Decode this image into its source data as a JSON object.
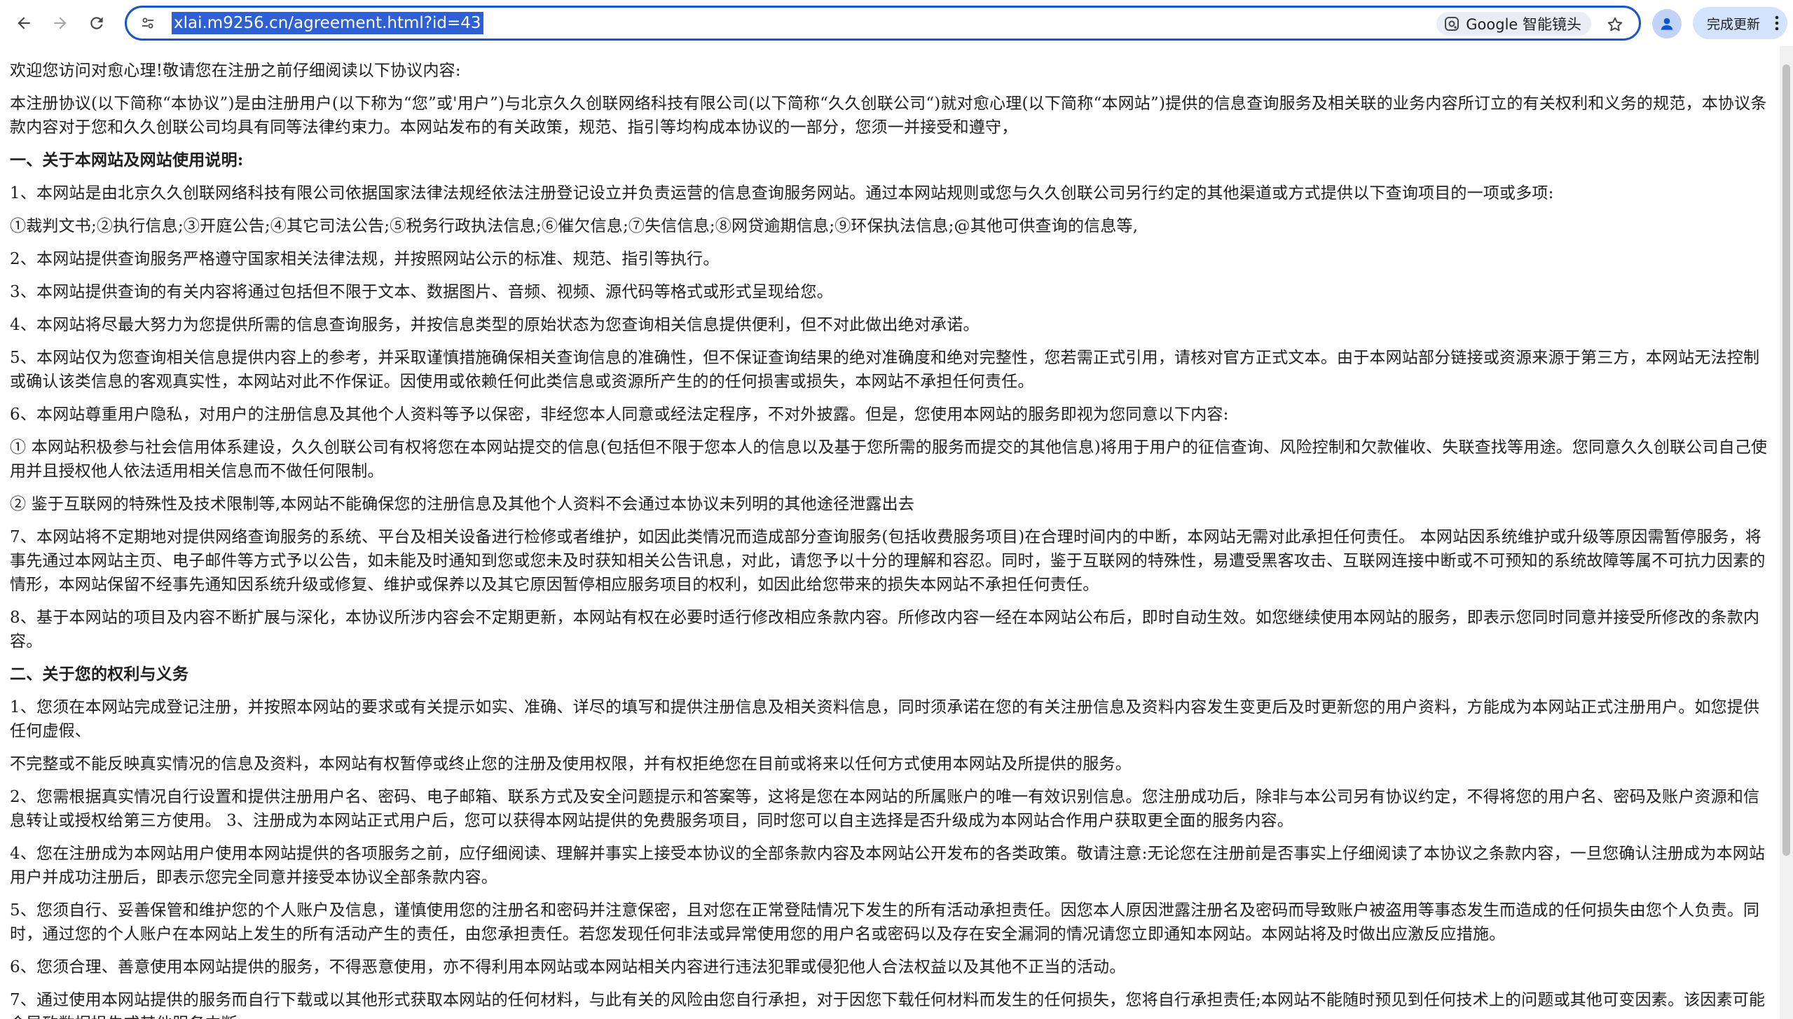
{
  "browser": {
    "url": "xlai.m9256.cn/agreement.html?id=43",
    "lens_label": "Google 智能镜头",
    "update_label": "完成更新"
  },
  "agreement": {
    "paragraphs": [
      {
        "type": "text",
        "text": "欢迎您访问对愈心理!敬请您在注册之前仔细阅读以下协议内容:"
      },
      {
        "type": "text",
        "text": "本注册协议(以下简称“本协议”)是由注册用户(以下称为“您”或'用户”)与北京久久创联网络科技有限公司(以下简称“久久创联公司“)就对愈心理(以下简称“本网站”)提供的信息查询服务及相关联的业务内容所订立的有关权利和义务的规范，本协议条款内容对于您和久久创联公司均具有同等法律约束力。本网站发布的有关政策，规范、指引等均构成本协议的一部分，您须一并接受和遵守，"
      },
      {
        "type": "heading",
        "text": "一、关于本网站及网站使用说明:"
      },
      {
        "type": "text",
        "text": "1、本网站是由北京久久创联网络科技有限公司依据国家法律法规经依法注册登记设立并负责运营的信息查询服务网站。通过本网站规则或您与久久创联公司另行约定的其他渠道或方式提供以下查询项目的一项或多项:"
      },
      {
        "type": "text",
        "text": "①裁判文书;②执行信息;③开庭公告;④其它司法公告;⑤税务行政执法信息;⑥催欠信息;⑦失信信息;⑧网贷逾期信息;⑨环保执法信息;@其他可供查询的信息等,"
      },
      {
        "type": "text",
        "text": "2、本网站提供查询服务严格遵守国家相关法律法规，并按照网站公示的标准、规范、指引等执行。"
      },
      {
        "type": "text",
        "text": "3、本网站提供查询的有关内容将通过包括但不限于文本、数据图片、音频、视频、源代码等格式或形式呈现给您。"
      },
      {
        "type": "text",
        "text": "4、本网站将尽最大努力为您提供所需的信息查询服务，并按信息类型的原始状态为您查询相关信息提供便利，但不对此做出绝对承诺。"
      },
      {
        "type": "text",
        "text": "5、本网站仅为您查询相关信息提供内容上的参考，并采取谨慎措施确保相关查询信息的准确性，但不保证查询结果的绝对准确度和绝对完整性，您若需正式引用，请核对官方正式文本。由于本网站部分链接或资源来源于第三方，本网站无法控制或确认该类信息的客观真实性，本网站对此不作保证。因使用或依赖任何此类信息或资源所产生的的任何损害或损失，本网站不承担任何责任。"
      },
      {
        "type": "text",
        "text": "6、本网站尊重用户隐私，对用户的注册信息及其他个人资料等予以保密，非经您本人同意或经法定程序，不对外披露。但是，您使用本网站的服务即视为您同意以下内容:"
      },
      {
        "type": "text",
        "text": "① 本网站积极参与社会信用体系建设，久久创联公司有权将您在本网站提交的信息(包括但不限于您本人的信息以及基于您所需的服务而提交的其他信息)将用于用户的征信查询、风险控制和欠款催收、失联查找等用途。您同意久久创联公司自己使用并且授权他人依法适用相关信息而不做任何限制。"
      },
      {
        "type": "text",
        "text": "② 鉴于互联网的特殊性及技术限制等,本网站不能确保您的注册信息及其他个人资料不会通过本协议未列明的其他途径泄露出去"
      },
      {
        "type": "text",
        "text": "7、本网站将不定期地对提供网络查询服务的系统、平台及相关设备进行检修或者维护，如因此类情况而造成部分查询服务(包括收费服务项目)在合理时间内的中断，本网站无需对此承担任何责任。 本网站因系统维护或升级等原因需暂停服务，将事先通过本网站主页、电子邮件等方式予以公告，如未能及时通知到您或您未及时获知相关公告讯息，对此，请您予以十分的理解和容忍。同时，鉴于互联网的特殊性，易遭受黑客攻击、互联网连接中断或不可预知的系统故障等属不可抗力因素的情形，本网站保留不经事先通知因系统升级或修复、维护或保养以及其它原因暂停相应服务项目的权利，如因此给您带来的损失本网站不承担任何责任。"
      },
      {
        "type": "text",
        "text": "8、基于本网站的项目及内容不断扩展与深化，本协议所涉内容会不定期更新，本网站有权在必要时适行修改相应条款内容。所修改内容一经在本网站公布后，即时自动生效。如您继续使用本网站的服务，即表示您同时同意并接受所修改的条款内容。"
      },
      {
        "type": "heading",
        "text": "二、关于您的权利与义务"
      },
      {
        "type": "text",
        "text": "1、您须在本网站完成登记注册，并按照本网站的要求或有关提示如实、准确、详尽的填写和提供注册信息及相关资料信息，同时须承诺在您的有关注册信息及资料内容发生变更后及时更新您的用户资料，方能成为本网站正式注册用户。如您提供任何虚假、"
      },
      {
        "type": "text",
        "text": "不完整或不能反映真实情况的信息及资料，本网站有权暂停或终止您的注册及使用权限，并有权拒绝您在目前或将来以任何方式使用本网站及所提供的服务。"
      },
      {
        "type": "text",
        "text": "2、您需根据真实情况自行设置和提供注册用户名、密码、电子邮箱、联系方式及安全问题提示和答案等，这将是您在本网站的所属账户的唯一有效识别信息。您注册成功后，除非与本公司另有协议约定，不得将您的用户名、密码及账户资源和信息转让或授权给第三方使用。    3、注册成为本网站正式用户后，您可以获得本网站提供的免费服务项目，同时您可以自主选择是否升级成为本网站合作用户获取更全面的服务内容。"
      },
      {
        "type": "text",
        "text": "4、您在注册成为本网站用户使用本网站提供的各项服务之前，应仔细阅读、理解并事实上接受本协议的全部条款内容及本网站公开发布的各类政策。敬请注意:无论您在注册前是否事实上仔细阅读了本协议之条款内容，一旦您确认注册成为本网站用户并成功注册后，即表示您完全同意并接受本协议全部条款内容。"
      },
      {
        "type": "text",
        "text": "5、您须自行、妥善保管和维护您的个人账户及信息，谨慎使用您的注册名和密码并注意保密，且对您在正常登陆情况下发生的所有活动承担责任。因您本人原因泄露注册名及密码而导致账户被盗用等事态发生而造成的任何损失由您个人负责。同时，通过您的个人账户在本网站上发生的所有活动产生的责任，由您承担责任。若您发现任何非法或异常使用您的用户名或密码以及存在安全漏洞的情况请您立即通知本网站。本网站将及时做出应激反应措施。"
      },
      {
        "type": "text",
        "text": "6、您须合理、善意使用本网站提供的服务，不得恶意使用，亦不得利用本网站或本网站相关内容进行违法犯罪或侵犯他人合法权益以及其他不正当的活动。"
      },
      {
        "type": "text",
        "text": "7、通过使用本网站提供的服务而自行下载或以其他形式获取本网站的任何材料，与此有关的风险由您自行承担，对于因您下载任何材料而发生的任何损失，您将自行承担责任;本网站不能随时预见到任何技术上的问题或其他可变因素。该因素可能会导致数据损失或其他服务中断。"
      }
    ]
  }
}
